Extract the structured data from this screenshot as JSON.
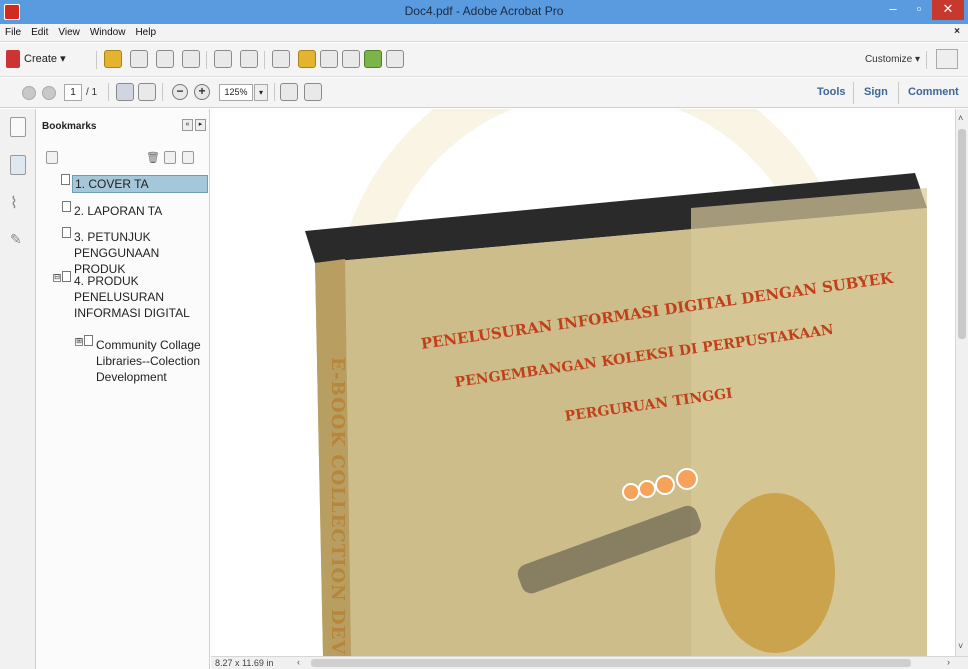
{
  "window": {
    "title": "Doc4.pdf - Adobe Acrobat Pro",
    "minimize": "–",
    "maximize": "▫",
    "close": "✕"
  },
  "menu": {
    "items": [
      "File",
      "Edit",
      "View",
      "Window",
      "Help"
    ],
    "doc_close": "×"
  },
  "toolbar": {
    "create_label": "Create ▾",
    "customize_label": "Customize ▾",
    "icons": [
      "open-icon",
      "save-icon",
      "cloud-icon",
      "print-icon",
      "edit-icon",
      "email-icon",
      "settings-icon",
      "comment-icon",
      "pages-icon",
      "export-icon",
      "combine-icon",
      "pdf-icon"
    ]
  },
  "nav": {
    "current_page": "1",
    "total_pages": "/ 1",
    "zoom": "125%",
    "zoom_dropdown": "▾",
    "zoom_out": "−",
    "zoom_in": "+",
    "tabs": [
      "Tools",
      "Sign",
      "Comment"
    ]
  },
  "bookmarks": {
    "title": "Bookmarks",
    "collapse_all": "«",
    "expand_all": "▸",
    "items": [
      {
        "label": "1. COVER TA",
        "selected": true
      },
      {
        "label": "2. LAPORAN TA"
      },
      {
        "label": "3. PETUNJUK PENGGUNAAN PRODUK"
      },
      {
        "label": "4. PRODUK PENELUSURAN INFORMASI DIGITAL",
        "expand": "⊟"
      },
      {
        "label": "Community Collage Libraries--Colection Development",
        "expand": "⊞"
      }
    ]
  },
  "document": {
    "book_title_line1": "PENELUSURAN INFORMASI DIGITAL DENGAN SUBYEK",
    "book_title_line2": "PENGEMBANGAN KOLEKSI DI PERPUSTAKAAN",
    "book_title_line3": "PERGURUAN TINGGI",
    "spine_text": "E-BOOK COLLECTION DEV",
    "page_size": "8.27 x 11.69 in"
  },
  "colors": {
    "titlebar": "#5a9be0",
    "tab_link": "#3e6696",
    "book_title": "#c1401a",
    "bookmark_selected": "#a4c8da"
  }
}
